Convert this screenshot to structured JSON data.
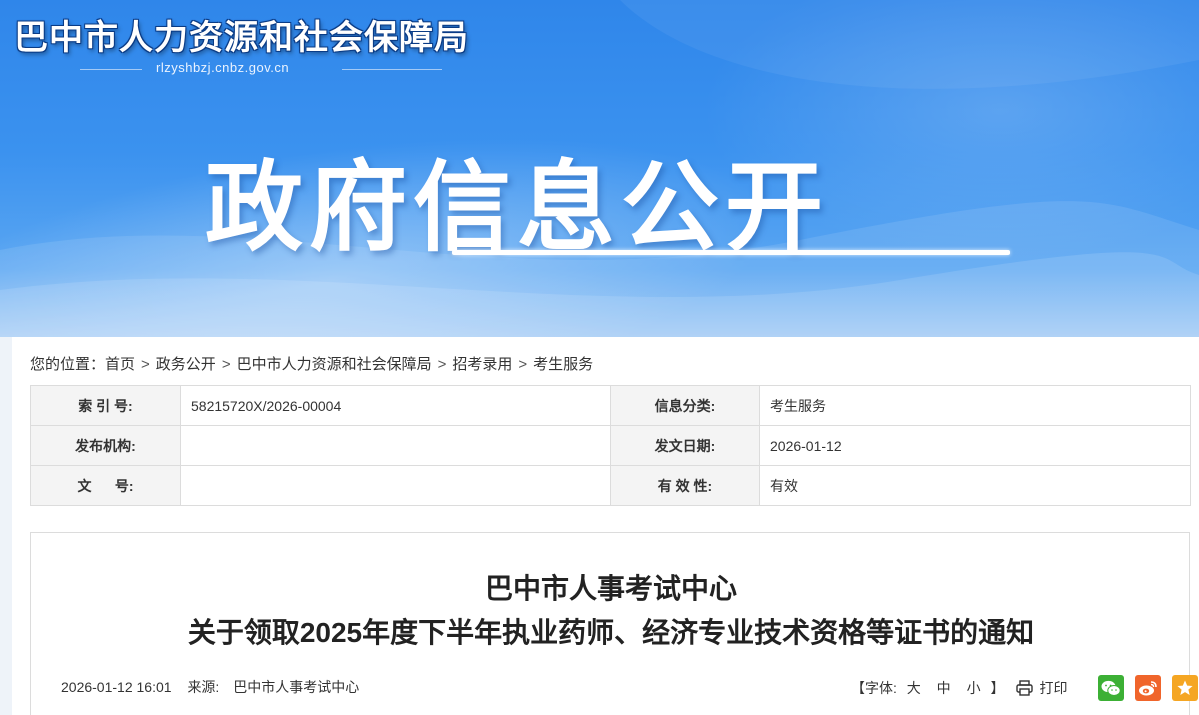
{
  "header": {
    "site_name": "巴中市人力资源和社会保障局",
    "domain": "rlzyshbzj.cnbz.gov.cn",
    "banner_title": "政府信息公开"
  },
  "breadcrumb": {
    "prefix": "您的位置：",
    "items": [
      "首页",
      "政务公开",
      "巴中市人力资源和社会保障局",
      "招考录用",
      "考生服务"
    ],
    "separator": ">"
  },
  "info_table": {
    "rows": [
      {
        "label1": "索 引 号:",
        "value1": "58215720X/2026-00004",
        "label2": "信息分类:",
        "value2": "考生服务"
      },
      {
        "label1": "发布机构:",
        "value1": "",
        "label2": "发文日期:",
        "value2": "2026-01-12"
      },
      {
        "label1": "文      号:",
        "value1": "",
        "label2": "有 效 性:",
        "value2": "有效"
      }
    ]
  },
  "article": {
    "title_line1": "巴中市人事考试中心",
    "title_line2": "关于领取2025年度下半年执业药师、经济专业技术资格等证书的通知",
    "datetime": "2026-01-12 16:01",
    "source_label": "来源:",
    "source": "巴中市人事考试中心"
  },
  "tools": {
    "font_label": "【字体:",
    "font_large": "大",
    "font_medium": "中",
    "font_small": "小",
    "font_close": "】",
    "print_label": "打印"
  },
  "colors": {
    "banner_blue": "#2f86ea",
    "wechat_green": "#3cb035",
    "weibo_orange": "#f0652b",
    "favorite_orange": "#f5a623"
  },
  "icons": [
    "print-icon",
    "wechat-icon",
    "weibo-icon",
    "star-icon"
  ]
}
